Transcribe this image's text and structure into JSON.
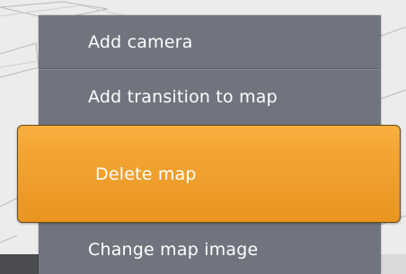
{
  "context_menu": {
    "items": [
      {
        "label": "Add camera"
      },
      {
        "label": "Add transition to map"
      },
      {
        "label": "Delete map",
        "highlighted": true
      },
      {
        "label": "Change map image"
      }
    ]
  },
  "colors": {
    "menu_background": "#6f747e",
    "highlight": "#f3a433",
    "text": "#ffffff",
    "map_background": "#ececec"
  }
}
